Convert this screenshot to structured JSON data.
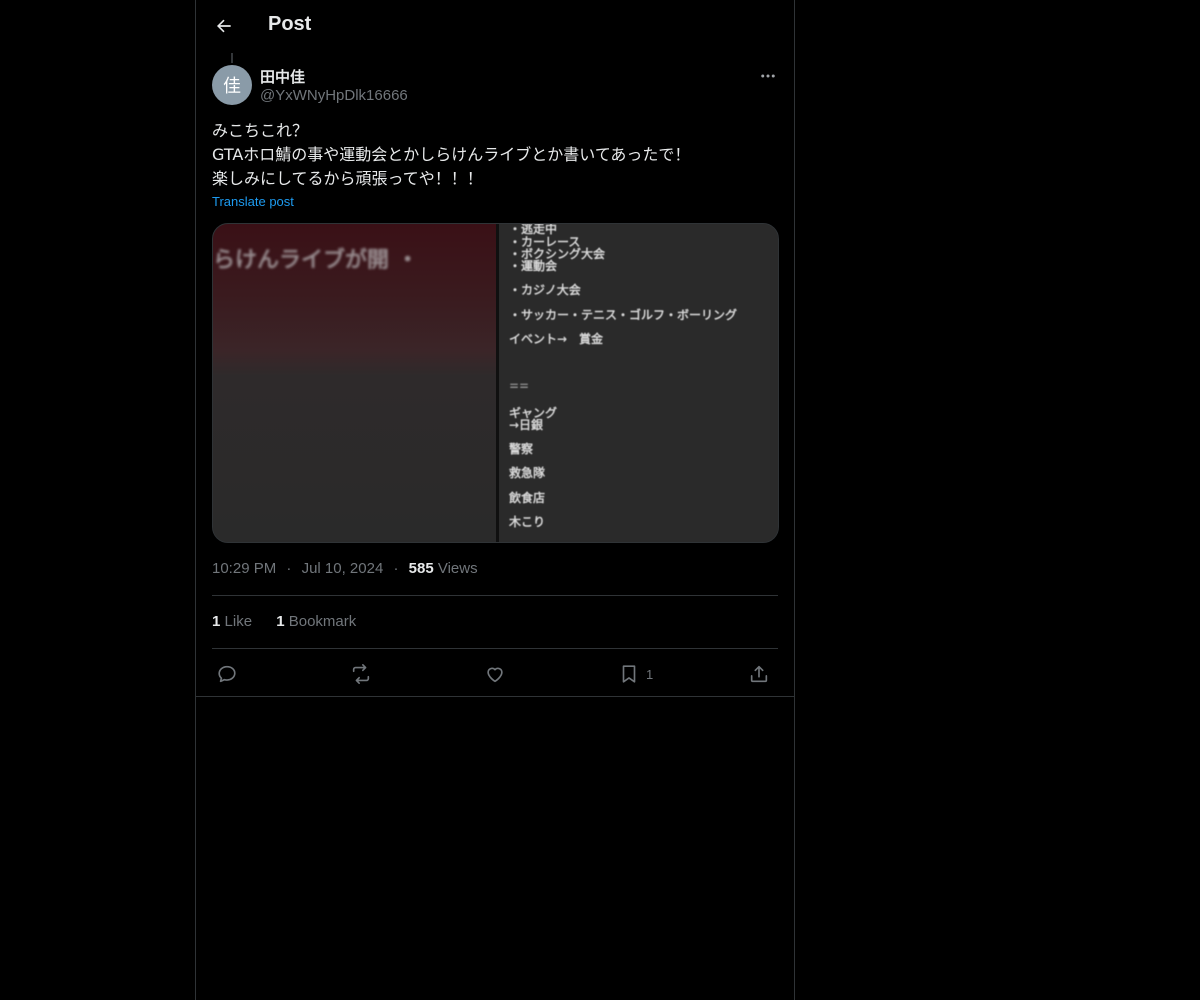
{
  "header": {
    "title": "Post"
  },
  "post": {
    "avatar_char": "佳",
    "author_name": "田中佳",
    "author_handle": "@YxWNyHpDlk16666",
    "text_lines": [
      "みこちこれ？",
      "GTAホロ鯖の事や運動会とかしらけんライブとか書いてあったで！",
      "楽しみにしてるから頑張ってや！！！"
    ],
    "translate_label": "Translate post",
    "time": "10:29 PM",
    "date": "Jul 10, 2024",
    "separator": "·",
    "views_count": "585",
    "views_label": "Views"
  },
  "media": {
    "left_text": "らけんライブが開 ・ ",
    "right_lines": [
      "・逃走中",
      "・カーレース",
      "・ボクシング大会",
      "・運動会",
      "・カジノ大会",
      "・サッカー・テニス・ゴルフ・ボーリング",
      "イベント→　賞金",
      "==",
      "ギャング",
      "→日銀",
      "警察",
      "救急隊",
      "飲食店",
      "木こり"
    ]
  },
  "stats": {
    "likes_count": "1",
    "likes_label": "Like",
    "bookmarks_count": "1",
    "bookmarks_label": "Bookmark"
  },
  "actions": {
    "bookmark_count": "1"
  },
  "colors": {
    "background": "#000000",
    "text_primary": "#e7e9ea",
    "text_secondary": "#71767b",
    "accent": "#1d9bf0",
    "border": "#2f3336",
    "avatar_bg": "#8a9ba8"
  }
}
